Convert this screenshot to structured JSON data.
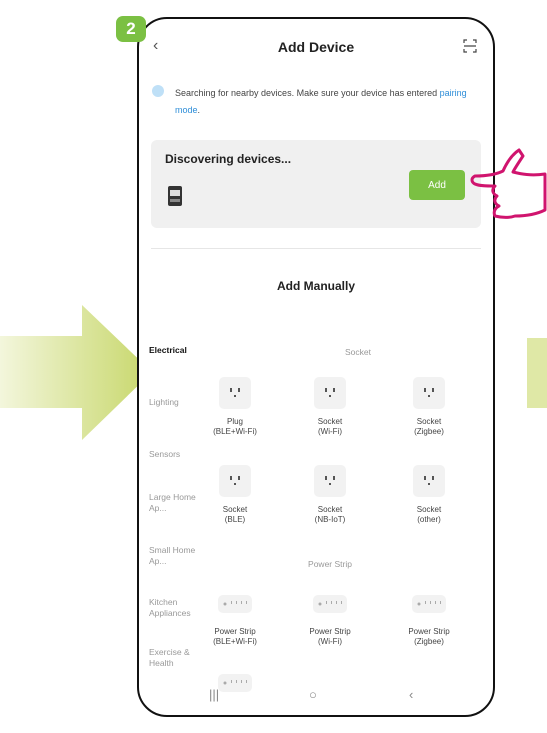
{
  "step": "2",
  "header": {
    "title": "Add Device"
  },
  "info": {
    "text_before": "Searching for nearby devices. Make sure your device has entered ",
    "link": "pairing mode",
    "text_after": "."
  },
  "discover": {
    "title": "Discovering devices...",
    "add_label": "Add"
  },
  "manual": {
    "title": "Add Manually"
  },
  "sidebar": {
    "items": [
      {
        "label": "Electrical",
        "active": true
      },
      {
        "label": "Lighting"
      },
      {
        "label": "Sensors"
      },
      {
        "label": "Large Home Ap..."
      },
      {
        "label": "Small Home Ap..."
      },
      {
        "label": "Kitchen Appliances"
      },
      {
        "label": "Exercise & Health"
      }
    ]
  },
  "sections": {
    "socket": {
      "title": "Socket",
      "tiles": [
        {
          "line1": "Plug",
          "line2": "(BLE+Wi-Fi)"
        },
        {
          "line1": "Socket",
          "line2": "(Wi-Fi)"
        },
        {
          "line1": "Socket",
          "line2": "(Zigbee)"
        },
        {
          "line1": "Socket",
          "line2": "(BLE)"
        },
        {
          "line1": "Socket",
          "line2": "(NB-IoT)"
        },
        {
          "line1": "Socket",
          "line2": "(other)"
        }
      ]
    },
    "power_strip": {
      "title": "Power Strip",
      "tiles": [
        {
          "line1": "Power Strip",
          "line2": "(BLE+Wi-Fi)"
        },
        {
          "line1": "Power Strip",
          "line2": "(Wi-Fi)"
        },
        {
          "line1": "Power Strip",
          "line2": "(Zigbee)"
        }
      ]
    }
  },
  "colors": {
    "accent": "#7bc043",
    "link": "#2f8ed8",
    "hand": "#d0146e",
    "arrow": "#c6d66a"
  }
}
